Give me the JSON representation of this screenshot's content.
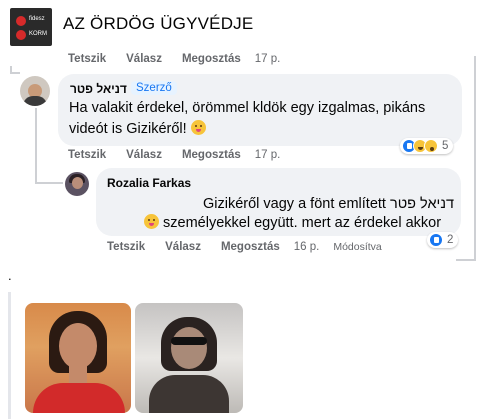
{
  "header": {
    "title": "AZ ÖRDÖG ÜGYVÉDJE",
    "thumb_line1": "fidesz",
    "thumb_line2": "KORM"
  },
  "actions_top": {
    "like": "Tetszik",
    "reply": "Válasz",
    "share": "Megosztás",
    "time": "17 p."
  },
  "comment1": {
    "author": "דניאל פטר",
    "badge": "Szerző",
    "text": "Ha valakit érdekel, örömmel kldök egy izgalmas, pikáns videót is Gizikéről!",
    "reaction_count": "5",
    "actions": {
      "like": "Tetszik",
      "reply": "Válasz",
      "share": "Megosztás",
      "time": "17 p."
    }
  },
  "comment2": {
    "author": "Rozalia Farkas",
    "text_line1": "Gizikéről vagy a fönt említett דניאל פטר",
    "text_line2": "személyekkel együtt. mert az érdekel akkor",
    "reaction_count": "2",
    "actions": {
      "like": "Tetszik",
      "reply": "Válasz",
      "share": "Megosztás",
      "time": "16 p.",
      "edited": "Módosítva"
    }
  },
  "separator_dot": ".",
  "colors": {
    "link_blue": "#1877f2",
    "bubble_bg": "#f0f2f5",
    "meta_gray": "#65676b",
    "thread_line": "#ced0d4"
  }
}
